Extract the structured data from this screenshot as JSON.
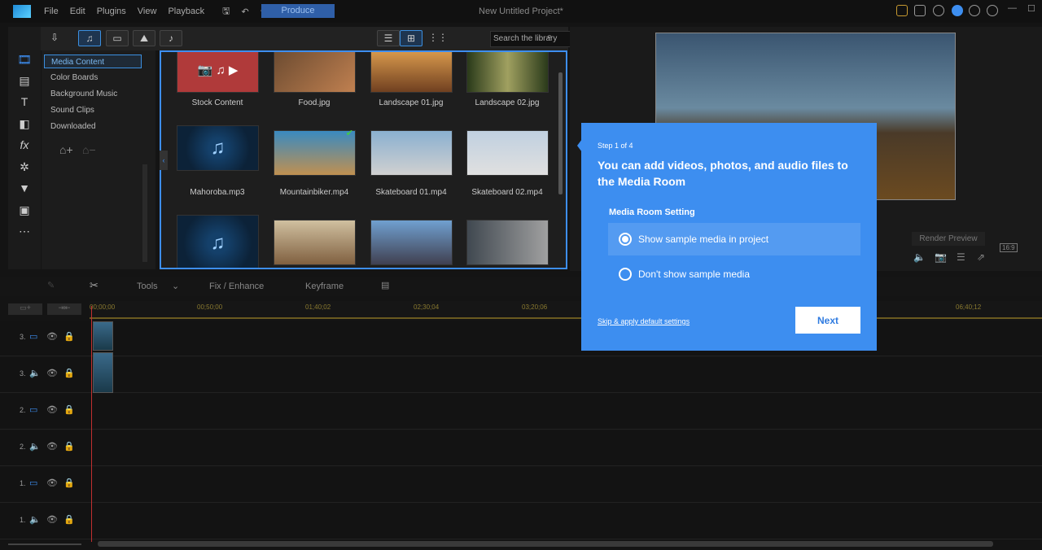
{
  "menu": [
    "File",
    "Edit",
    "Plugins",
    "View",
    "Playback"
  ],
  "produce": "Produce",
  "project_title": "New Untitled Project*",
  "library": {
    "search_placeholder": "Search the library",
    "categories": [
      "Media Content",
      "Color Boards",
      "Background Music",
      "Sound Clips",
      "Downloaded"
    ],
    "items": [
      "Stock Content",
      "Food.jpg",
      "Landscape 01.jpg",
      "Landscape 02.jpg",
      "Mahoroba.mp3",
      "Mountainbiker.mp4",
      "Skateboard 01.mp4",
      "Skateboard 02.mp4",
      "",
      "",
      "",
      ""
    ]
  },
  "preview": {
    "render_preview": "Render Preview",
    "aspect": "16:9"
  },
  "dialog": {
    "step": "Step 1 of 4",
    "heading": "You can add videos, photos, and audio files to the Media Room",
    "setting_title": "Media Room Setting",
    "options": [
      "Show sample media in project",
      "Don't show sample media"
    ],
    "selected": 0,
    "skip": "Skip & apply default settings",
    "next": "Next"
  },
  "timeline": {
    "tools": "Tools",
    "fix": "Fix / Enhance",
    "keyframe": "Keyframe",
    "ticks": [
      "00;00;00",
      "00;50;00",
      "01;40;02",
      "02;30;04",
      "03;20;06",
      "06;40;12"
    ],
    "tracks": [
      "3.",
      "3.",
      "2.",
      "2.",
      "1.",
      "1."
    ]
  },
  "colors": {
    "accent": "#3d8ef0"
  }
}
